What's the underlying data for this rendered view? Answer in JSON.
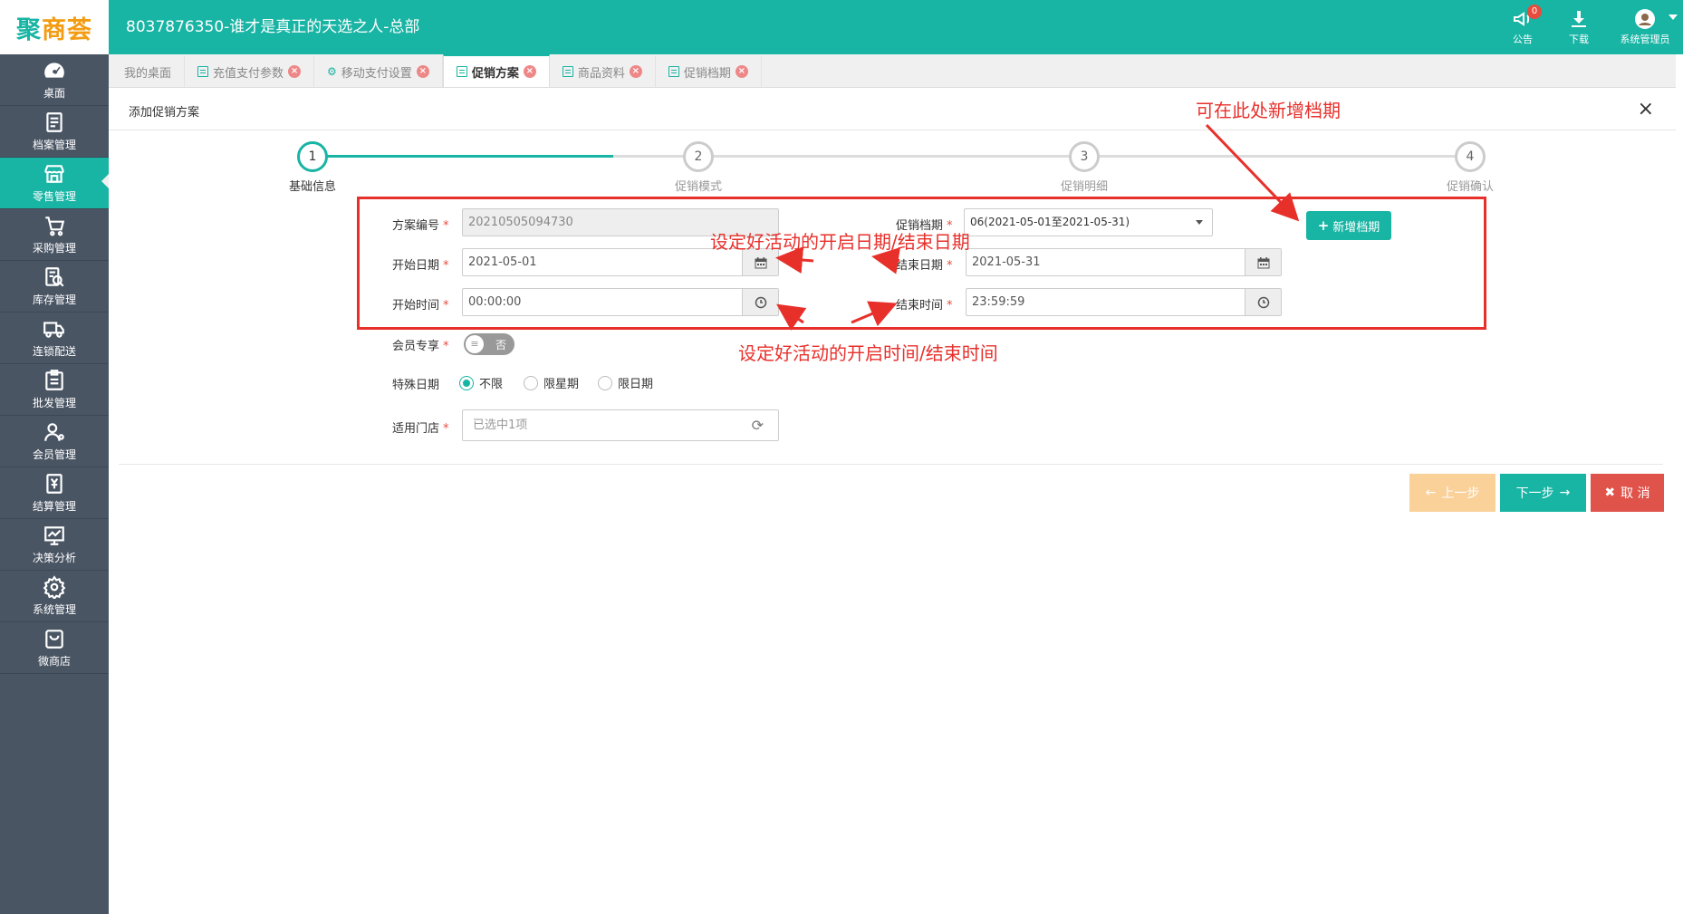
{
  "header": {
    "logo_main": "聚",
    "logo_accent": "商荟",
    "title": "8037876350-谁才是真正的天选之人-总部",
    "actions": {
      "notice_label": "公告",
      "notice_badge": "0",
      "download_label": "下载",
      "user_label": "系统管理员"
    }
  },
  "sidebar": {
    "items": [
      {
        "label": "桌面",
        "icon": "dashboard-icon"
      },
      {
        "label": "档案管理",
        "icon": "archive-icon"
      },
      {
        "label": "零售管理",
        "icon": "store-icon",
        "active": true
      },
      {
        "label": "采购管理",
        "icon": "cart-icon"
      },
      {
        "label": "库存管理",
        "icon": "inventory-icon"
      },
      {
        "label": "连锁配送",
        "icon": "truck-icon"
      },
      {
        "label": "批发管理",
        "icon": "wholesale-icon"
      },
      {
        "label": "会员管理",
        "icon": "member-icon"
      },
      {
        "label": "结算管理",
        "icon": "settlement-icon"
      },
      {
        "label": "决策分析",
        "icon": "analysis-icon"
      },
      {
        "label": "系统管理",
        "icon": "gear-icon"
      },
      {
        "label": "微商店",
        "icon": "shop-bag-icon"
      }
    ]
  },
  "tabs": [
    {
      "label": "我的桌面"
    },
    {
      "label": "充值支付参数"
    },
    {
      "label": "移动支付设置"
    },
    {
      "label": "促销方案",
      "active": true
    },
    {
      "label": "商品资料"
    },
    {
      "label": "促销档期"
    }
  ],
  "panel": {
    "title": "添加促销方案",
    "close": "×"
  },
  "steps": [
    {
      "num": "1",
      "label": "基础信息",
      "active": true
    },
    {
      "num": "2",
      "label": "促销模式"
    },
    {
      "num": "3",
      "label": "促销明细"
    },
    {
      "num": "4",
      "label": "促销确认"
    }
  ],
  "form": {
    "plan_no_label": "方案编号",
    "plan_no_value": "20210505094730",
    "schedule_label": "促销档期",
    "schedule_value": "06(2021-05-01至2021-05-31)",
    "add_schedule_btn": "新增档期",
    "start_date_label": "开始日期",
    "start_date_value": "2021-05-01",
    "end_date_label": "结束日期",
    "end_date_value": "2021-05-31",
    "start_time_label": "开始时间",
    "start_time_value": "00:00:00",
    "end_time_label": "结束时间",
    "end_time_value": "23:59:59",
    "member_only_label": "会员专享",
    "member_only_value": "否",
    "special_date_label": "特殊日期",
    "special_options": [
      "不限",
      "限星期",
      "限日期"
    ],
    "special_selected": "不限",
    "stores_label": "适用门店",
    "stores_value": "已选中1项",
    "required_mark": "*"
  },
  "buttons": {
    "prev": "上一步",
    "next": "下一步",
    "cancel": "取 消"
  },
  "annotations": {
    "add_schedule_hint": "可在此处新增档期",
    "date_hint": "设定好活动的开启日期/结束日期",
    "time_hint": "设定好活动的开启时间/结束时间",
    "color": "#e8302b"
  },
  "colors": {
    "brand": "#18b4a4",
    "sidebar": "#4a5564",
    "cancel": "#e0534b",
    "prev_disabled": "#fbd19a"
  }
}
